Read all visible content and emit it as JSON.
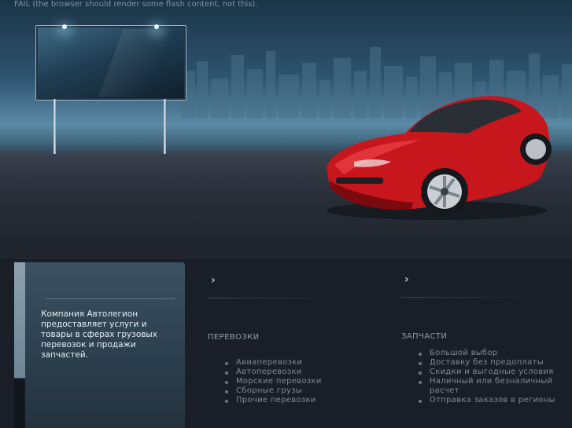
{
  "flash_message": "FAIL (the browser should render some flash content, not this).",
  "intro_text": "Компания Автолегион предоставляет услуги и товары в сферах грузовых перевозок и продажи запчастей.",
  "columns": [
    {
      "heading": "ПЕРЕВОЗКИ",
      "items": [
        "Авиаперевозки",
        "Автоперевозки",
        "Морские перевозки",
        "Сборные грузы",
        "Прочие перевозки"
      ]
    },
    {
      "heading": "ЗАПЧАСТИ",
      "items": [
        "Большой выбор",
        "Доставку без предоплаты",
        "Скидки и выгодные условия",
        "Наличный или безналичный расчет",
        "Отправка заказов в регионы"
      ]
    }
  ],
  "icons": {
    "column_marker": "chevron-right-icon",
    "list_bullet": "bullet-icon"
  },
  "colors": {
    "car": "#c8161d",
    "page_background": "#1a1f27",
    "panel": "#2b3e4c"
  }
}
